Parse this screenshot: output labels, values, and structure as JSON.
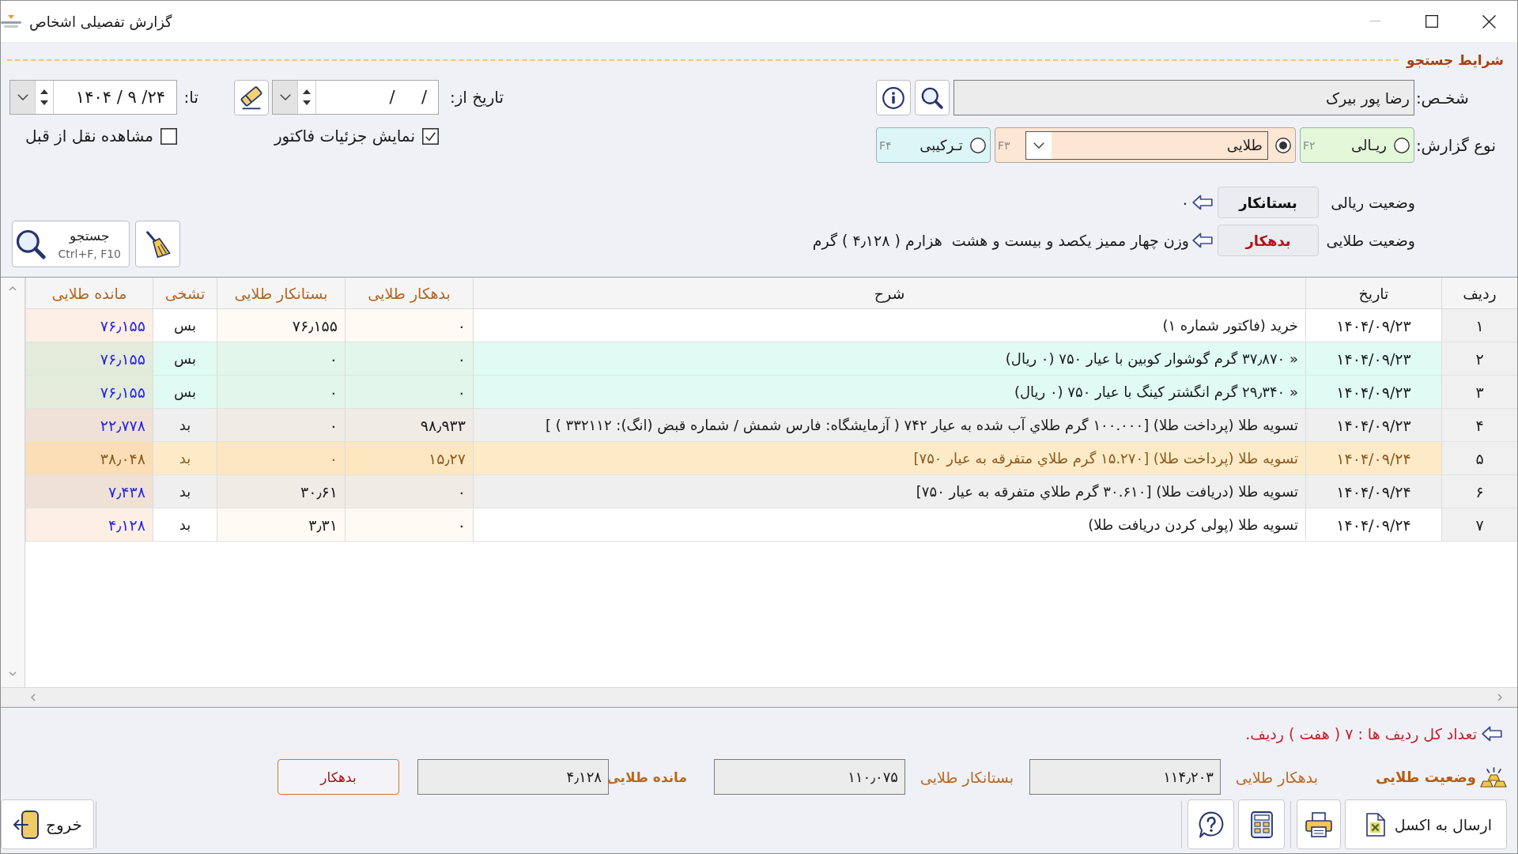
{
  "window": {
    "title": "گزارش تفصیلی اشخاص",
    "controls": [
      {
        "kind": "minimize",
        "disabled": true
      },
      {
        "kind": "maximize",
        "disabled": false
      },
      {
        "kind": "close",
        "disabled": false
      }
    ]
  },
  "search": {
    "heading": "شرایط جستجو",
    "person": {
      "label": "شخـص:",
      "value": "رضا پور بیرک"
    },
    "report_type": {
      "label": "نوع گزارش:",
      "options": [
        {
          "kind": "radio",
          "label": "ریـالی",
          "shortcut": "F۲",
          "selected": false,
          "color": "#e3f8d9"
        },
        {
          "kind": "combo",
          "value": "طلایی",
          "shortcut": "F۳",
          "selected": true,
          "color": "#fde6d3"
        },
        {
          "kind": "radio",
          "label": "تـرکیبی",
          "shortcut": "F۴",
          "selected": false,
          "color": "#dcf6f8"
        }
      ]
    },
    "date_from": {
      "label": "تاریخ از:",
      "value": "/     /"
    },
    "date_to": {
      "label": "تا:",
      "value": "۱۴۰۴ / ۹ /۲۴"
    },
    "options": [
      {
        "label": "نمایش جزئیات فاکتور",
        "checked": true
      },
      {
        "label": "مشاهده نقل از قبل",
        "checked": false
      }
    ],
    "search_button": {
      "label": "جستجو",
      "shortcut": "Ctrl+F, F10"
    }
  },
  "balances": [
    {
      "label": "وضعیت ریالی",
      "value": "بستانکار",
      "color": "#111111",
      "detail": "۰"
    },
    {
      "label": "وضعیت طلایی",
      "value": "بدهکار",
      "color": "#b0151a",
      "detail": "وزن چهار ممیز یکصد و بیست و هشت  هزارم ( ۴٫۱۲۸ ) گرم"
    }
  ],
  "table": {
    "columns": [
      {
        "label": "ردیف",
        "kind": "index"
      },
      {
        "label": "تاریخ",
        "kind": "date"
      },
      {
        "label": "شرح",
        "kind": "text"
      },
      {
        "label": "بدهکار طلایی",
        "kind": "amount"
      },
      {
        "label": "بستانکار طلایی",
        "kind": "amount"
      },
      {
        "label": "تشخی",
        "kind": "flag"
      },
      {
        "label": "مانده طلایی",
        "kind": "balance"
      }
    ],
    "rows": [
      {
        "color": "#ffffff",
        "selected": false,
        "cells": [
          "۱",
          "۱۴۰۴/۰۹/۲۳",
          "خرید (فاکتور شماره ۱)",
          "۰",
          "۷۶٫۱۵۵",
          "بس",
          "۷۶٫۱۵۵"
        ]
      },
      {
        "color": "#e0fbf4",
        "selected": false,
        "cells": [
          "۲",
          "۱۴۰۴/۰۹/۲۳",
          "« ۳۷٫۸۷۰ گرم گوشوار کوبین با عیار ۷۵۰ (۰ ریال)",
          "۰",
          "۰",
          "بس",
          "۷۶٫۱۵۵"
        ]
      },
      {
        "color": "#e0fbf4",
        "selected": false,
        "cells": [
          "۳",
          "۱۴۰۴/۰۹/۲۳",
          "« ۲۹٫۳۴۰ گرم انگشتر کینگ با عیار ۷۵۰ (۰ ریال)",
          "۰",
          "۰",
          "بس",
          "۷۶٫۱۵۵"
        ]
      },
      {
        "color": "#efefef",
        "selected": false,
        "cells": [
          "۴",
          "۱۴۰۴/۰۹/۲۳",
          "تسویه طلا (پرداخت طلا) [۱۰۰.۰۰۰ گرم طلاي آب شده به عیار ۷۴۲ ( آزمایشگاه: فارس شمش / شماره قبض (انگ): ۳۳۲۱۱۲ ) ]",
          "۹۸٫۹۳۳",
          "۰",
          "بد",
          "۲۲٫۷۷۸"
        ]
      },
      {
        "color": "#fdebc8",
        "selected": true,
        "cells": [
          "۵",
          "۱۴۰۴/۰۹/۲۴",
          "تسویه طلا (پرداخت طلا) [۱۵.۲۷۰ گرم طلاي متفرقه به عیار ۷۵۰]",
          "۱۵٫۲۷",
          "۰",
          "بد",
          "۳۸٫۰۴۸"
        ]
      },
      {
        "color": "#efefef",
        "selected": false,
        "cells": [
          "۶",
          "۱۴۰۴/۰۹/۲۴",
          "تسویه طلا (دریافت طلا) [۳۰.۶۱۰ گرم طلاي متفرقه به عیار ۷۵۰]",
          "۰",
          "۳۰٫۶۱",
          "بد",
          "۷٫۴۳۸"
        ]
      },
      {
        "color": "#ffffff",
        "selected": false,
        "cells": [
          "۷",
          "۱۴۰۴/۰۹/۲۴",
          "تسویه طلا (پولی کردن دریافت طلا)",
          "۰",
          "۳٫۳۱",
          "بد",
          "۴٫۱۲۸"
        ]
      }
    ]
  },
  "summary": {
    "row_count": "تعداد کل ردیف ها : ۷ ( هفت ) ردیف.",
    "title": "وضعیت طلایی",
    "fields": [
      {
        "kind": "amount",
        "label": "بدهکار طلایی",
        "value": "۱۱۴٫۲۰۳"
      },
      {
        "kind": "amount",
        "label": "بستانکار طلایی",
        "value": "۱۱۰٫۰۷۵"
      },
      {
        "kind": "balance",
        "label": "مانده طلایی",
        "value": "۴٫۱۲۸"
      }
    ],
    "balance_status": "بدهکار"
  },
  "actions": {
    "buttons": [
      {
        "kind": "excel",
        "label": "ارسال به اکسل"
      },
      {
        "kind": "print"
      },
      {
        "kind": "calculator"
      },
      {
        "kind": "help"
      }
    ],
    "exit": {
      "label": "خروج"
    }
  }
}
